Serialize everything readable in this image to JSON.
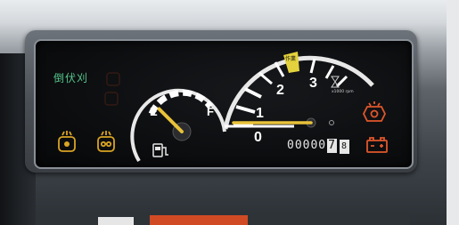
{
  "panel": {
    "mode_label": "倒伏刈"
  },
  "fuel_gauge": {
    "empty_label": "E",
    "full_label": "F",
    "level_fraction": 0.05,
    "icon": "fuel-pump-icon"
  },
  "tachometer": {
    "tick_labels": [
      "0",
      "1",
      "2",
      "3"
    ],
    "unit_label": "x1000 rpm",
    "work_zone_label": "作業",
    "reading_x1000_rpm": 0,
    "max_x1000_rpm": 3.5
  },
  "odometer": {
    "digits": "00000",
    "last_digit": "7",
    "tenth_digit": "8"
  },
  "indicators": {
    "left": [
      "engine-preheat-icon",
      "glow-plug-icon"
    ],
    "right": [
      "oil-pressure-icon",
      "battery-charge-icon"
    ]
  },
  "colors": {
    "needle": "#e8c23a",
    "warning": "#e0572b",
    "amber": "#d9a423",
    "mode_text": "#55c48a",
    "work_zone": "#e3d23d"
  }
}
